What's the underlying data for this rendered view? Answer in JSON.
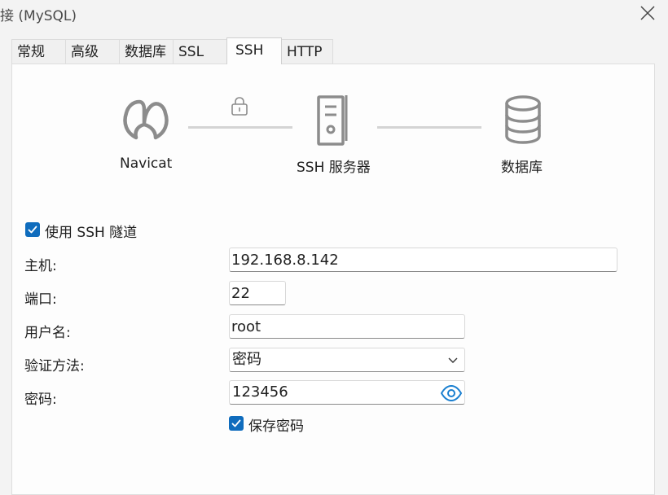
{
  "window": {
    "title": "接 (MySQL)"
  },
  "tabs": [
    {
      "label": "常规"
    },
    {
      "label": "高级"
    },
    {
      "label": "数据库"
    },
    {
      "label": "SSL"
    },
    {
      "label": "SSH",
      "active": true
    },
    {
      "label": "HTTP"
    }
  ],
  "diagram": {
    "client_label": "Navicat",
    "server_label": "SSH 服务器",
    "database_label": "数据库",
    "icons": [
      "navicat-logo-icon",
      "lock-icon",
      "server-icon",
      "database-icon"
    ]
  },
  "ssh_tunnel": {
    "label": "使用 SSH 隧道",
    "checked": true
  },
  "form": {
    "host": {
      "label": "主机:",
      "value": "192.168.8.142"
    },
    "port": {
      "label": "端口:",
      "value": "22"
    },
    "username": {
      "label": "用户名:",
      "value": "root"
    },
    "auth_method": {
      "label": "验证方法:",
      "value": "密码"
    },
    "password": {
      "label": "密码:",
      "value": "123456"
    },
    "save_password": {
      "label": "保存密码",
      "checked": true
    }
  },
  "colors": {
    "accent": "#0f6cbd",
    "eye_icon": "#1a7fd0",
    "diagram_icon": "#8c8c8c",
    "line": "#d4d4d4"
  }
}
